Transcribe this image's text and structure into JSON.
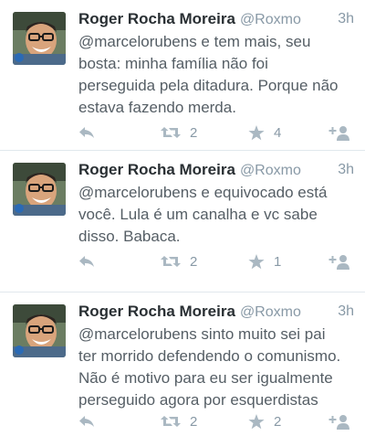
{
  "tweets": [
    {
      "name": "Roger Rocha Moreira",
      "handle": "@Roxmo",
      "time": "3h",
      "text_lines": [
        "@marcelorubens e tem mais, seu",
        "bosta: minha família não foi",
        "perseguida pela ditadura. Porque não",
        "estava fazendo merda."
      ],
      "retweets": "2",
      "favorites": "4"
    },
    {
      "name": "Roger Rocha Moreira",
      "handle": "@Roxmo",
      "time": "3h",
      "text_lines": [
        "@marcelorubens e equivocado está",
        "você. Lula é um canalha e vc sabe",
        "disso. Babaca."
      ],
      "retweets": "2",
      "favorites": "1"
    },
    {
      "name": "Roger Rocha Moreira",
      "handle": "@Roxmo",
      "time": "3h",
      "text_lines": [
        "@marcelorubens sinto muito sei pai",
        "ter morrido defendendo o comunismo.",
        "Não é motivo para eu ser igualmente",
        "perseguido agora por esquerdistas"
      ],
      "retweets": "2",
      "favorites": "2"
    }
  ],
  "icons": {
    "reply": "reply-icon",
    "retweet": "retweet-icon",
    "favorite": "star-icon",
    "follow": "follow-icon"
  },
  "colors": {
    "name": "#292f33",
    "text": "#555e65",
    "muted": "#8899a6",
    "icon": "#aab8c2",
    "divider": "#e1e8ed"
  }
}
